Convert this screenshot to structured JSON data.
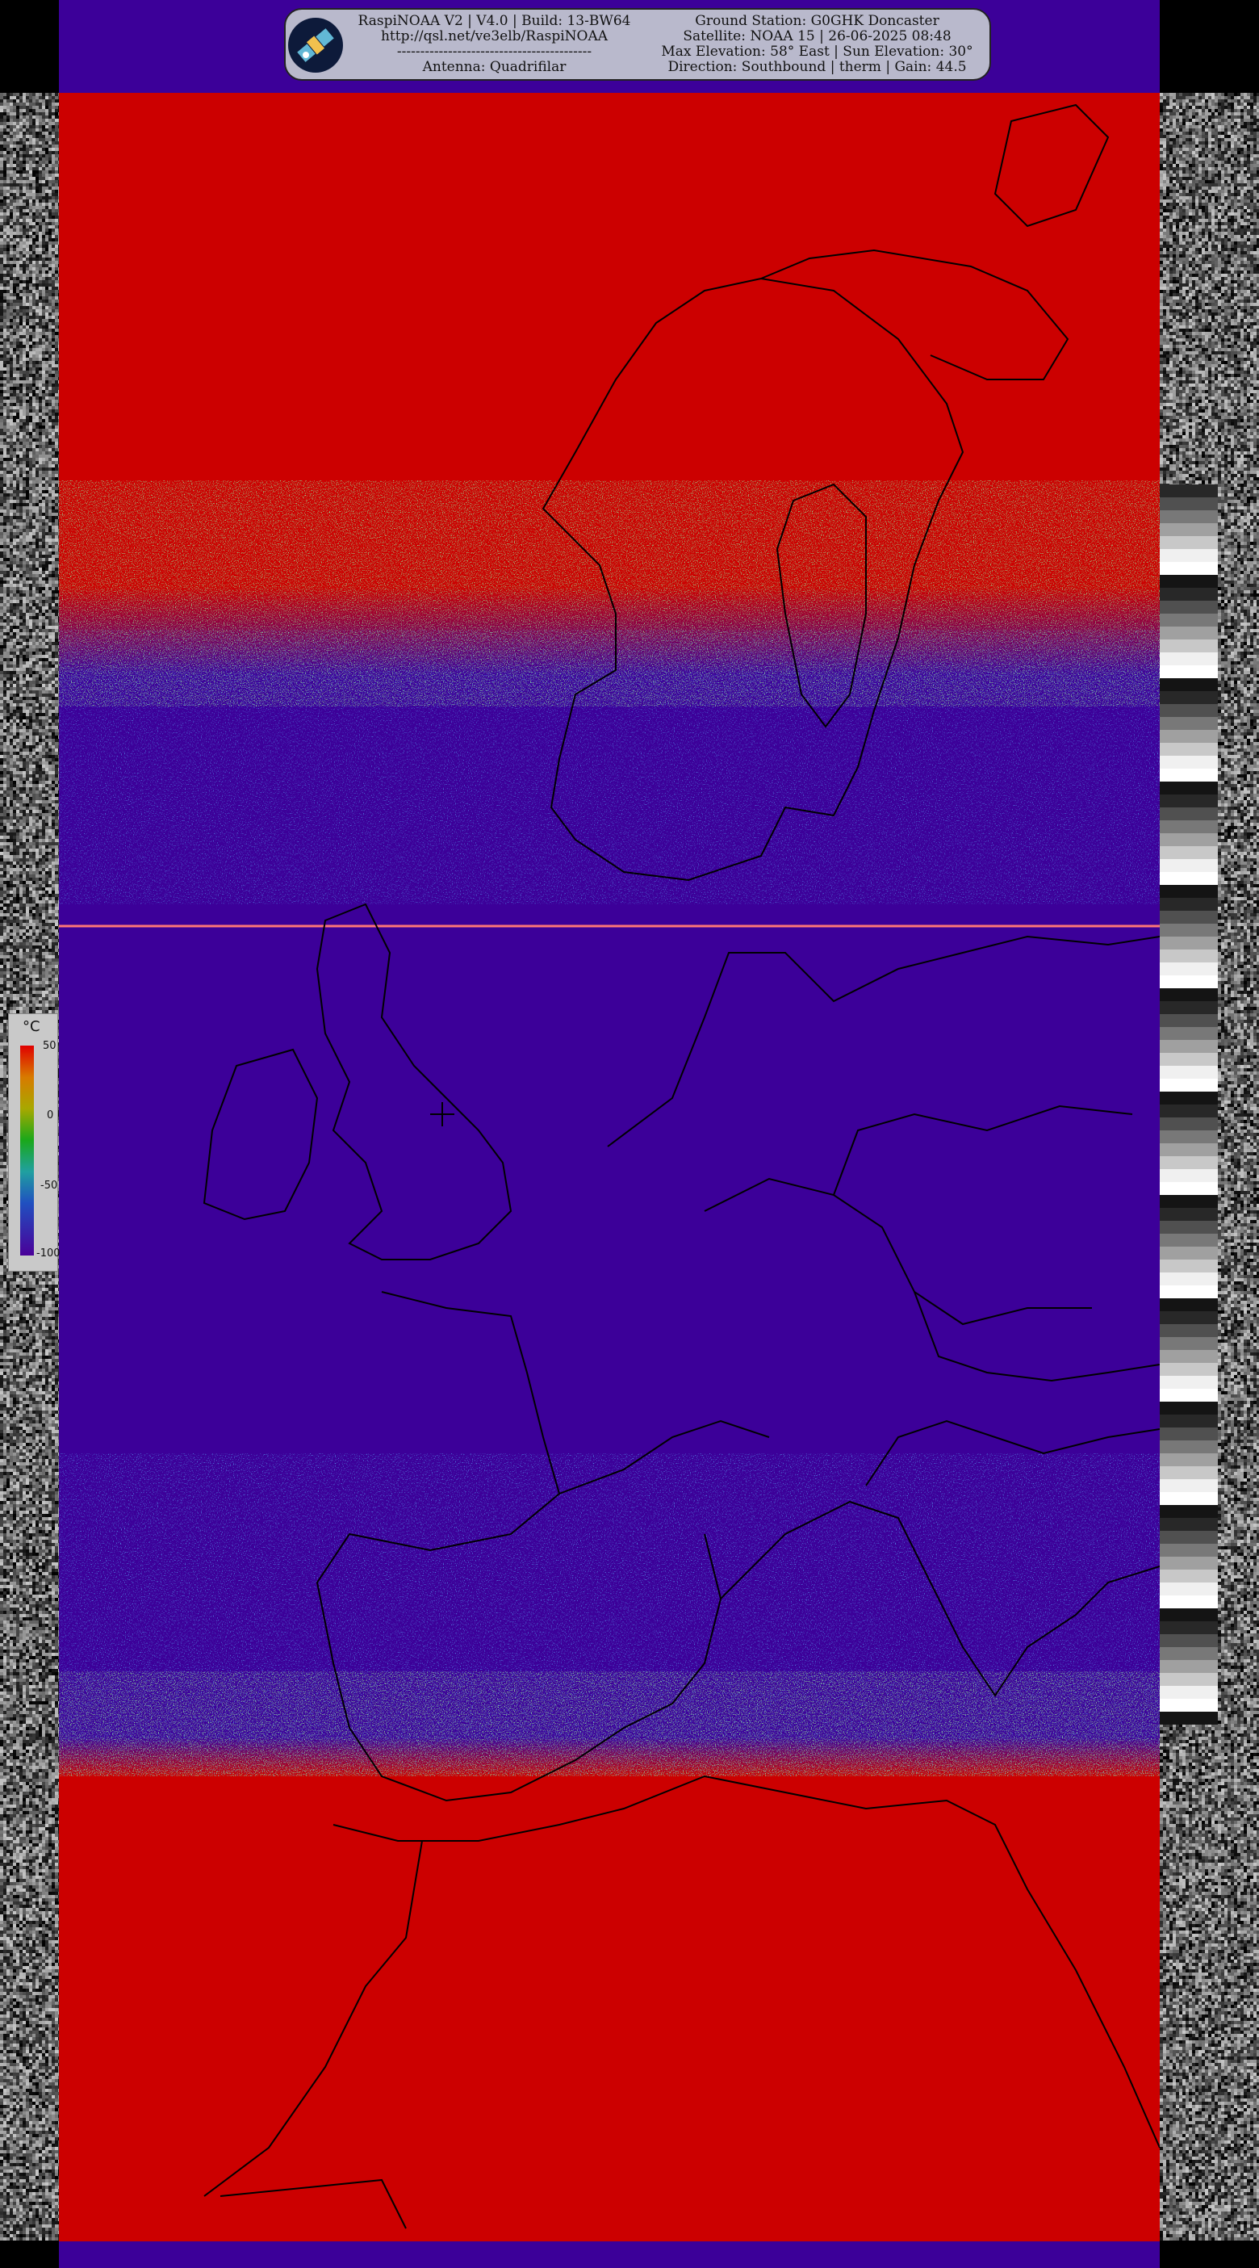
{
  "header": {
    "left_lines": [
      "RaspiNOAA V2 | V4.0 | Build: 13-BW64",
      "http://qsl.net/ve3elb/RaspiNOAA",
      "------------------------------------------",
      "Antenna: Quadrifilar"
    ],
    "right_lines": [
      "Ground Station: G0GHK Doncaster",
      "Satellite: NOAA 15 | 26-06-2025 08:48",
      "Max Elevation: 58° East | Sun Elevation: 30°",
      "Direction: Southbound | therm | Gain: 44.5"
    ],
    "logo_icon": "satellite-logo-icon"
  },
  "legend": {
    "unit": "°C",
    "ticks": [
      "50",
      "0",
      "-50",
      "-100"
    ]
  },
  "colors": {
    "warm": "#cc0000",
    "cold": "#3c0099",
    "panel": "#b9b9cc",
    "coastline": "#000000"
  }
}
